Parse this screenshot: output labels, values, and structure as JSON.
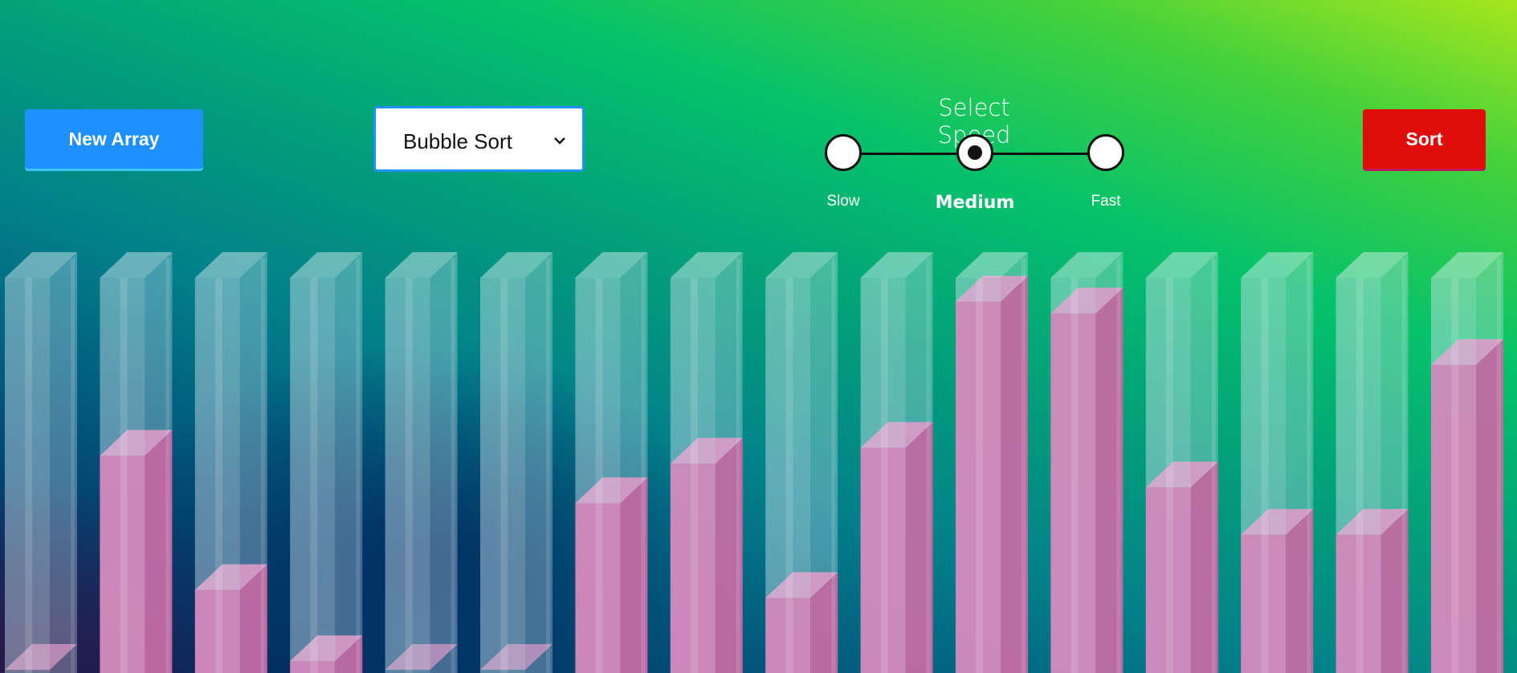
{
  "toolbar": {
    "new_array_label": "New Array",
    "algorithm_selected": "Bubble Sort",
    "sort_label": "Sort"
  },
  "speed": {
    "title": "Select Speed",
    "options": [
      "Slow",
      "Medium",
      "Fast"
    ],
    "selected": "Medium"
  },
  "colors": {
    "new_array_button": "#1e90ff",
    "sort_button": "#e00d0d",
    "fill": "#d23d92",
    "glass": "#cfe4ee"
  },
  "array": {
    "values": [
      0,
      55,
      21,
      3,
      0,
      0,
      43,
      53,
      19,
      57,
      94,
      91,
      47,
      35,
      35,
      78
    ]
  }
}
